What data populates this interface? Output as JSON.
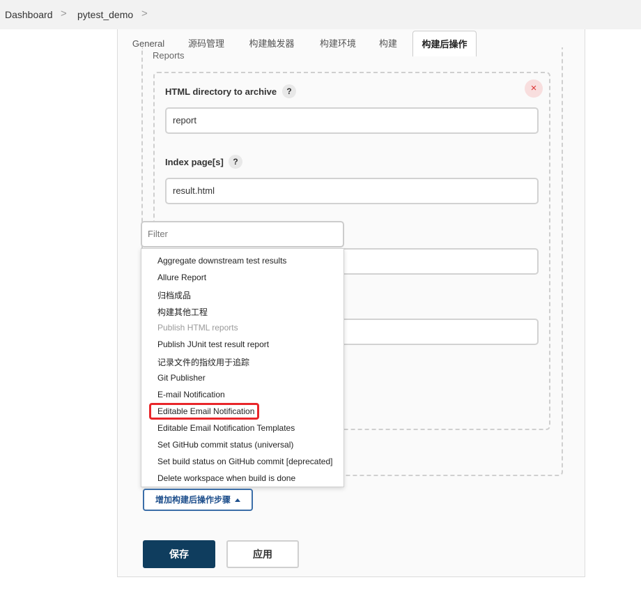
{
  "breadcrumb": {
    "items": [
      "Dashboard",
      "pytest_demo"
    ],
    "separator": ">"
  },
  "tabs": [
    {
      "label": "General"
    },
    {
      "label": "源码管理"
    },
    {
      "label": "构建触发器"
    },
    {
      "label": "构建环境"
    },
    {
      "label": "构建"
    },
    {
      "label": "构建后操作",
      "active": true
    }
  ],
  "section": {
    "label": "Reports",
    "close_symbol": "×"
  },
  "fields": {
    "html_dir": {
      "label": "HTML directory to archive",
      "value": "report",
      "help": "?"
    },
    "index_pages": {
      "label": "Index page[s]",
      "value": "result.html",
      "help": "?"
    }
  },
  "filter": {
    "placeholder": "Filter"
  },
  "dropdown": {
    "items": [
      {
        "label": "Aggregate downstream test results"
      },
      {
        "label": "Allure Report"
      },
      {
        "label": "归档成品"
      },
      {
        "label": "构建其他工程"
      },
      {
        "label": "Publish HTML reports",
        "disabled": true
      },
      {
        "label": "Publish JUnit test result report"
      },
      {
        "label": "记录文件的指纹用于追踪"
      },
      {
        "label": "Git Publisher"
      },
      {
        "label": "E-mail Notification"
      },
      {
        "label": "Editable Email Notification",
        "highlighted": true
      },
      {
        "label": "Editable Email Notification Templates"
      },
      {
        "label": "Set GitHub commit status (universal)"
      },
      {
        "label": "Set build status on GitHub commit [deprecated]"
      },
      {
        "label": "Delete workspace when build is done"
      }
    ]
  },
  "buttons": {
    "add_step": "增加构建后操作步骤",
    "save": "保存",
    "apply": "应用"
  },
  "colors": {
    "primary": "#0f3d5e",
    "link": "#1e4f8c",
    "highlight": "#e8262a"
  }
}
